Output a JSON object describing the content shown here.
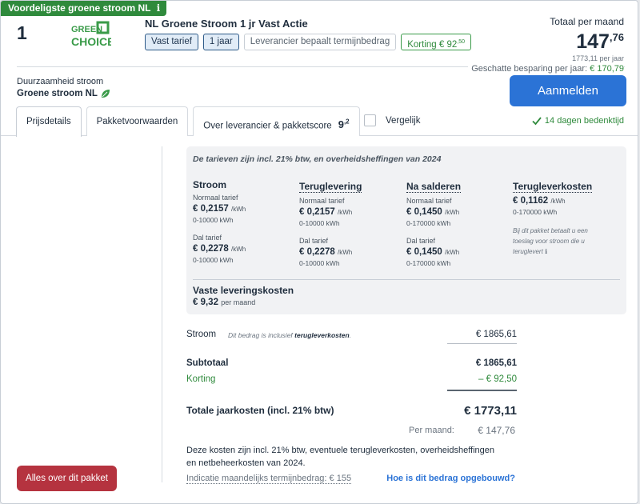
{
  "promo": {
    "label": "Voordeligste groene stroom NL",
    "info_icon": "info-icon"
  },
  "rank": "1",
  "logo": {
    "line1": "GREEN",
    "line2": "CHOICE"
  },
  "product": {
    "title": "NL Groene Stroom 1 jr Vast Actie",
    "tags": [
      "Vast tarief",
      "1 jaar",
      "Leverancier bepaalt termijnbedrag"
    ],
    "discount_label": "Korting € 92",
    "discount_cents": ",50"
  },
  "price": {
    "label": "Totaal per maand",
    "main": "147",
    "cents": ",76",
    "yearly": "1773,11 per jaar",
    "saving_label": "Geschatte besparing per jaar:",
    "saving_value": "€ 170,79"
  },
  "duurzaamheid": {
    "label": "Duurzaamheid stroom",
    "value": "Groene stroom NL"
  },
  "cta": "Aanmelden",
  "tabs": [
    {
      "label": "Prijsdetails"
    },
    {
      "label": "Pakketvoorwaarden"
    },
    {
      "label": "Over leverancier & pakketscore",
      "score": "9",
      "score_dec": ",2"
    }
  ],
  "compare": "Vergelijk",
  "bedenktijd": "14 dagen bedenktijd",
  "side_button": "Alles over dit pakket",
  "rates": {
    "note": "De tarieven zijn incl. 21% btw, en overheidsheffingen van 2024",
    "columns": [
      {
        "title": "Stroom",
        "sub1": "Normaal tarief",
        "val1": "€ 0,2157",
        "unit1": "/kWh",
        "range1": "0-10000 kWh",
        "sub2": "Dal tarief",
        "val2": "€ 0,2278",
        "unit2": "/kWh",
        "range2": "0-10000 kWh"
      },
      {
        "title": "Teruglevering",
        "sub1": "Normaal tarief",
        "val1": "€ 0,2157",
        "unit1": "/kWh",
        "range1": "0-10000 kWh",
        "sub2": "Dal tarief",
        "val2": "€ 0,2278",
        "unit2": "/kWh",
        "range2": "0-10000 kWh"
      },
      {
        "title": "Na salderen",
        "sub1": "Normaal tarief",
        "val1": "€ 0,1450",
        "unit1": "/kWh",
        "range1": "0-170000 kWh",
        "sub2": "Dal tarief",
        "val2": "€ 0,1450",
        "unit2": "/kWh",
        "range2": "0-170000 kWh"
      },
      {
        "title": "Terugleverkosten",
        "val1": "€ 0,1162",
        "unit1": "/kWh",
        "range1": "0-170000 kWh",
        "note": "Bij dit pakket betaalt u een toeslag voor stroom die u teruglevert"
      }
    ],
    "vaste": {
      "title": "Vaste leveringskosten",
      "value": "€ 9,32",
      "unit": "per maand"
    }
  },
  "costs": {
    "stroom_label": "Stroom",
    "stroom_note_pre": "Dit bedrag is inclusief ",
    "stroom_note_bold": "terugleverkosten",
    "stroom_note_post": ".",
    "stroom_value": "€ 1865,61",
    "subtotaal_label": "Subtotaal",
    "subtotaal_value": "€ 1865,61",
    "korting_label": "Korting",
    "korting_value": "– € 92,50",
    "total_label": "Totale jaarkosten (incl. 21% btw)",
    "total_value": "€ 1773,11",
    "permaand_label": "Per maand:",
    "permaand_value": "€ 147,76",
    "footnote": "Deze kosten zijn incl. 21% btw, eventuele terugleverkosten, overheidsheffingen en netbeheerkosten van 2024.",
    "indicatie": "Indicatie maandelijks termijnbedrag: € 155",
    "how_link": "Hoe is dit bedrag opgebouwd?"
  }
}
